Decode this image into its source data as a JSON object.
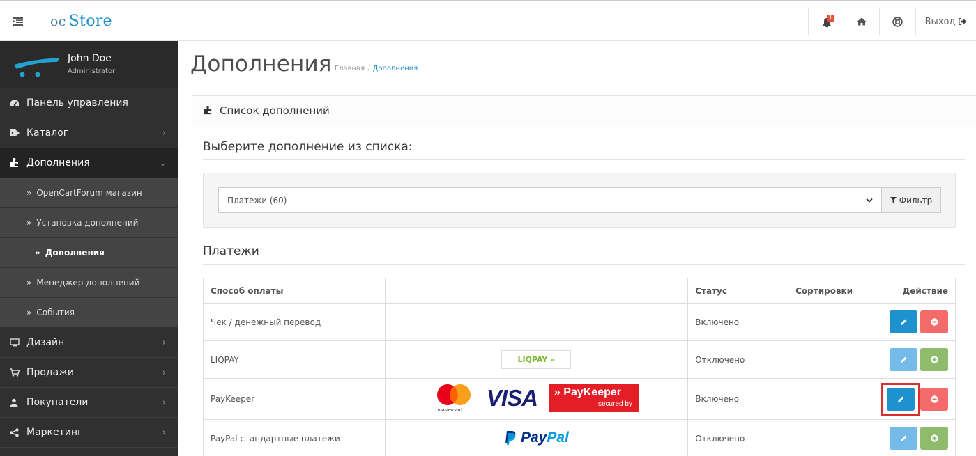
{
  "header": {
    "logo_prefix": "oc",
    "logo_main": "Store",
    "alert_count": "1",
    "logout_label": "Выход",
    "icons": [
      "menu-icon",
      "bell-icon",
      "home-icon",
      "life-ring-icon",
      "sign-out-icon"
    ]
  },
  "profile": {
    "name": "John Doe",
    "role": "Administrator"
  },
  "sidebar": {
    "items": [
      {
        "label": "Панель управления",
        "icon": "dashboard-icon"
      },
      {
        "label": "Каталог",
        "icon": "tag-icon"
      },
      {
        "label": "Дополнения",
        "icon": "puzzle-icon"
      },
      {
        "label": "Дизайн",
        "icon": "monitor-icon"
      },
      {
        "label": "Продажи",
        "icon": "cart-icon"
      },
      {
        "label": "Покупатели",
        "icon": "user-icon"
      },
      {
        "label": "Маркетинг",
        "icon": "share-icon"
      }
    ],
    "subitems": [
      {
        "label": "OpenCartForum магазин"
      },
      {
        "label": "Установка дополнений"
      },
      {
        "label": "Дополнения"
      },
      {
        "label": "Менеджер дополнений"
      },
      {
        "label": "События"
      }
    ]
  },
  "page": {
    "title": "Дополнения",
    "breadcrumb": [
      "Главная",
      "Дополнения"
    ]
  },
  "panel": {
    "heading": "Список дополнений",
    "select_prompt": "Выберите дополнение из списка:",
    "filter_value": "Платежи (60)",
    "filter_button": "Фильтр",
    "section_title": "Платежи"
  },
  "table": {
    "headers": [
      "Способ оплаты",
      "",
      "Статус",
      "Сортировки",
      "Действие"
    ],
    "rows": [
      {
        "name": "Чек / денежный перевод",
        "logo": "",
        "status": "Включено",
        "sort": "",
        "enabled": true
      },
      {
        "name": "LIQPAY",
        "logo": "LIQPAY",
        "status": "Отключено",
        "sort": "",
        "enabled": false
      },
      {
        "name": "PayKeeper",
        "logo": "paykeeper",
        "status": "Включено",
        "sort": "",
        "enabled": true
      },
      {
        "name": "PayPal стандартные платежи",
        "logo": "paypal",
        "status": "Отключено",
        "sort": "",
        "enabled": false
      }
    ]
  },
  "logos": {
    "liqpay_text": "LIQPAY",
    "mastercard_text": "mastercard",
    "visa_text": "VISA",
    "paykeeper_text": "PayKeeper",
    "paykeeper_sub": "secured by",
    "paypal_pay": "Pay",
    "paypal_pal": "Pal"
  },
  "colors": {
    "primary": "#1e91cf",
    "danger": "#f56b6b",
    "success": "#8fbb6c",
    "sidebar": "#303030",
    "highlight": "#d9302f"
  }
}
